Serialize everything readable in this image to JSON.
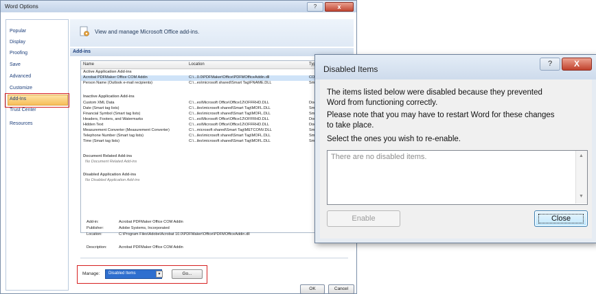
{
  "word_options": {
    "title": "Word Options",
    "help_glyph": "?",
    "close_glyph": "x",
    "nav": [
      "Popular",
      "Display",
      "Proofing",
      "Save",
      "Advanced",
      "Customize",
      "Add-Ins",
      "Trust Center",
      "Resources"
    ],
    "header": "View and manage Microsoft Office add-ins.",
    "section": "Add-ins",
    "columns": [
      "Name",
      "Location",
      "Type"
    ],
    "active_group": "Active Application Add-ins",
    "active_rows": [
      {
        "name": "Acrobat PDFMaker Office COM Addin",
        "location": "C:\\...0.0\\PDFMaker\\Office\\PDFMOfficeAddin.dll",
        "type": "COM"
      },
      {
        "name": "Person Name (Outlook e-mail recipients)",
        "location": "C:\\...es\\microsoft shared\\Smart Tag\\FNAME.DLL",
        "type": "Sma"
      }
    ],
    "inactive_group": "Inactive Application Add-ins",
    "inactive_rows": [
      {
        "name": "Custom XML Data",
        "location": "C:\\...es\\Microsoft Office\\Office12\\OFFRHD.DLL",
        "type": "Doc"
      },
      {
        "name": "Date (Smart tag lists)",
        "location": "C:\\...iles\\microsoft shared\\Smart Tag\\MOFL.DLL",
        "type": "Sma"
      },
      {
        "name": "Financial Symbol (Smart tag lists)",
        "location": "C:\\...iles\\microsoft shared\\Smart Tag\\MOFL.DLL",
        "type": "Sma"
      },
      {
        "name": "Headers, Footers, and Watermarks",
        "location": "C:\\...es\\Microsoft Office\\Office12\\OFFRHD.DLL",
        "type": "Doc"
      },
      {
        "name": "Hidden Text",
        "location": "C:\\...es\\Microsoft Office\\Office12\\OFFRHD.DLL",
        "type": "Doc"
      },
      {
        "name": "Measurement Converter (Measurement Converter)",
        "location": "C:\\...microsoft shared\\Smart Tag\\METCONV.DLL",
        "type": "Sma"
      },
      {
        "name": "Telephone Number (Smart tag lists)",
        "location": "C:\\...iles\\microsoft shared\\Smart Tag\\MOFL.DLL",
        "type": "Sma"
      },
      {
        "name": "Time (Smart tag lists)",
        "location": "C:\\...iles\\microsoft shared\\Smart Tag\\MOFL.DLL",
        "type": "Sma"
      }
    ],
    "doc_group": "Document Related Add-ins",
    "doc_none": "No Document Related Add-ins",
    "disabled_group": "Disabled Application Add-ins",
    "disabled_none": "No Disabled Application Add-ins",
    "details": {
      "addin_label": "Add-in:",
      "addin_value": "Acrobat PDFMaker Office COM Addin",
      "publisher_label": "Publisher:",
      "publisher_value": "Adobe Systems, Incorporated",
      "location_label": "Location:",
      "location_value": "C:\\Program Files\\Adobe\\Acrobat 10.0\\PDFMaker\\Office\\PDFMOfficeAddin.dll",
      "description_label": "Description:",
      "description_value": "Acrobat PDFMaker Office COM Addin"
    },
    "manage_label": "Manage:",
    "manage_value": "Disabled Items",
    "go_label": "Go...",
    "ok_label": "OK",
    "cancel_label": "Cancel"
  },
  "disabled_items": {
    "title": "Disabled Items",
    "help_glyph": "?",
    "close_glyph": "X",
    "line1": "The items listed below were disabled because they prevented",
    "line2": "Word from functioning correctly.",
    "line3": "Please note that you may have to restart Word for these changes",
    "line4": "to take place.",
    "line5": "Select the ones you wish to re-enable.",
    "empty_text": "There are no disabled items.",
    "enable_label": "Enable",
    "close_label": "Close"
  }
}
